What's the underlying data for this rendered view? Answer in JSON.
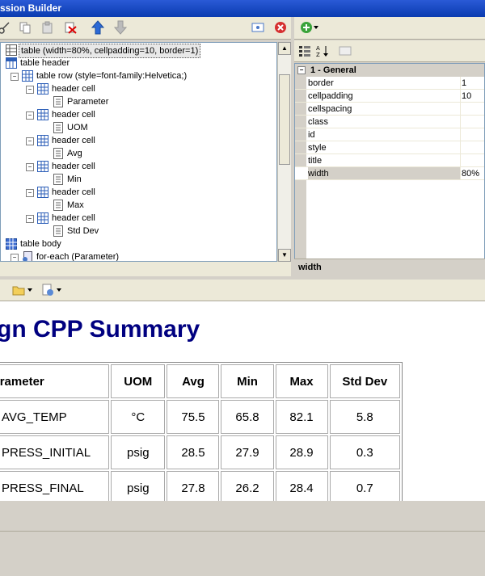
{
  "window": {
    "title": "ssion Builder"
  },
  "tree": {
    "items": [
      {
        "label": "table (width=80%, cellpadding=10, border=1)",
        "level": 0,
        "icon": "table-icon",
        "selected": true
      },
      {
        "label": "table header",
        "level": 0,
        "icon": "table-header-icon"
      },
      {
        "label": "table row (style=font-family:Helvetica;)",
        "level": 1,
        "icon": "table-row-icon"
      },
      {
        "label": "header cell",
        "level": 2,
        "icon": "header-cell-icon"
      },
      {
        "label": "Parameter",
        "level": 3,
        "icon": "text-icon"
      },
      {
        "label": "header cell",
        "level": 2,
        "icon": "header-cell-icon"
      },
      {
        "label": "UOM",
        "level": 3,
        "icon": "text-icon"
      },
      {
        "label": "header cell",
        "level": 2,
        "icon": "header-cell-icon"
      },
      {
        "label": "Avg",
        "level": 3,
        "icon": "text-icon"
      },
      {
        "label": "header cell",
        "level": 2,
        "icon": "header-cell-icon"
      },
      {
        "label": "Min",
        "level": 3,
        "icon": "text-icon"
      },
      {
        "label": "header cell",
        "level": 2,
        "icon": "header-cell-icon"
      },
      {
        "label": "Max",
        "level": 3,
        "icon": "text-icon"
      },
      {
        "label": "header cell",
        "level": 2,
        "icon": "header-cell-icon"
      },
      {
        "label": "Std Dev",
        "level": 3,
        "icon": "text-icon"
      },
      {
        "label": "table body",
        "level": 0,
        "icon": "table-body-icon"
      },
      {
        "label": "for-each (Parameter)",
        "level": 1,
        "icon": "for-each-icon"
      }
    ]
  },
  "properties": {
    "category": "1 - General",
    "rows": [
      {
        "name": "border",
        "value": "1"
      },
      {
        "name": "cellpadding",
        "value": "10"
      },
      {
        "name": "cellspacing",
        "value": ""
      },
      {
        "name": "class",
        "value": ""
      },
      {
        "name": "id",
        "value": ""
      },
      {
        "name": "style",
        "value": ""
      },
      {
        "name": "title",
        "value": ""
      },
      {
        "name": "width",
        "value": "80%"
      }
    ],
    "description": "width"
  },
  "preview": {
    "title": "mpaign CPP Summary",
    "headers": [
      "Parameter",
      "UOM",
      "Avg",
      "Min",
      "Max",
      "Std Dev"
    ],
    "rows": [
      [
        "AVG_TEMP",
        "°C",
        "75.5",
        "65.8",
        "82.1",
        "5.8"
      ],
      [
        "PRESS_INITIAL",
        "psig",
        "28.5",
        "27.9",
        "28.9",
        "0.3"
      ],
      [
        "PRESS_FINAL",
        "psig",
        "27.8",
        "26.2",
        "28.4",
        "0.7"
      ]
    ]
  },
  "colors": {
    "title_bar": "#0a3bb0",
    "preview_title": "#000080"
  }
}
